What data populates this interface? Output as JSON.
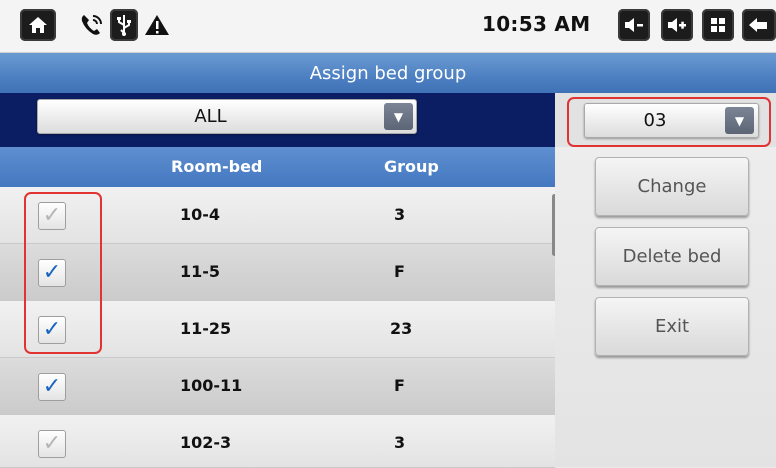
{
  "status_bar": {
    "time": "10:53 AM",
    "icons": [
      "home-icon",
      "phone-signal-icon",
      "usb-icon",
      "warning-icon",
      "volume-down-icon",
      "volume-up-icon",
      "menu-grid-icon",
      "back-icon"
    ]
  },
  "title": "Assign bed group",
  "filter": {
    "selected": "ALL"
  },
  "group_select": {
    "selected": "03"
  },
  "table": {
    "headers": {
      "room_bed": "Room-bed",
      "group": "Group"
    },
    "rows": [
      {
        "room_bed": "10-4",
        "group": "3",
        "checked": true,
        "enabled": false
      },
      {
        "room_bed": "11-5",
        "group": "F",
        "checked": true,
        "enabled": true
      },
      {
        "room_bed": "11-25",
        "group": "23",
        "checked": true,
        "enabled": true
      },
      {
        "room_bed": "100-11",
        "group": "F",
        "checked": true,
        "enabled": true
      },
      {
        "room_bed": "102-3",
        "group": "3",
        "checked": true,
        "enabled": false
      }
    ]
  },
  "actions": {
    "change": "Change",
    "delete_bed": "Delete bed",
    "exit": "Exit"
  },
  "check_glyph": "✓",
  "dropdown_arrow": "▼",
  "colors": {
    "title_bar": "#4d80c2",
    "header": "#4377c0",
    "check_enabled": "#1565c0",
    "check_disabled": "#b5b5b5",
    "highlight": "#e23333"
  }
}
